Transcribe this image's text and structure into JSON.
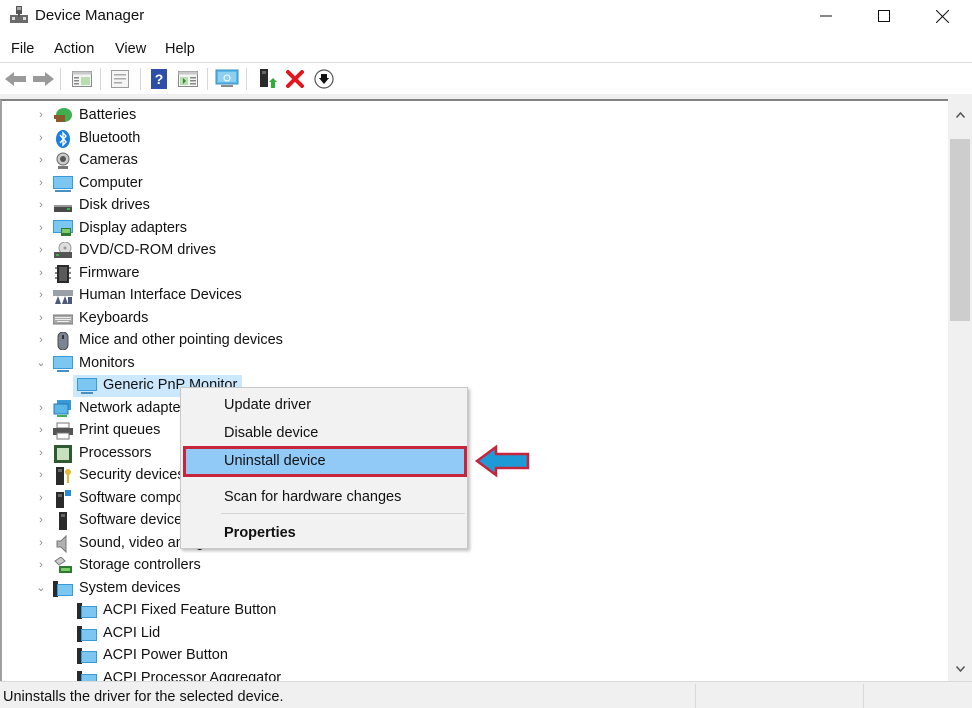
{
  "window": {
    "title": "Device Manager",
    "icon": "device-manager-icon",
    "controls": {
      "minimize": "minimize-icon",
      "maximize": "maximize-icon",
      "close": "close-icon"
    }
  },
  "menubar": {
    "items": [
      "File",
      "Action",
      "View",
      "Help"
    ]
  },
  "toolbar": {
    "buttons": [
      {
        "name": "back",
        "icon": "back-arrow-icon"
      },
      {
        "name": "forward",
        "icon": "forward-arrow-icon"
      },
      {
        "name": "show-hide-console-tree",
        "icon": "console-tree-icon"
      },
      {
        "name": "properties",
        "icon": "properties-icon"
      },
      {
        "name": "help",
        "icon": "help-icon"
      },
      {
        "name": "show-action-pane",
        "icon": "action-pane-icon"
      },
      {
        "name": "scan-hardware",
        "icon": "monitor-scan-icon"
      },
      {
        "name": "update-driver",
        "icon": "update-driver-icon"
      },
      {
        "name": "uninstall-device",
        "icon": "red-x-icon"
      },
      {
        "name": "disable-device",
        "icon": "down-arrow-circle-icon"
      }
    ]
  },
  "tree": {
    "nodes": [
      {
        "label": "Batteries",
        "icon": "battery-icon",
        "expanded": false,
        "level": 0
      },
      {
        "label": "Bluetooth",
        "icon": "bluetooth-icon",
        "expanded": false,
        "level": 0
      },
      {
        "label": "Cameras",
        "icon": "camera-icon",
        "expanded": false,
        "level": 0
      },
      {
        "label": "Computer",
        "icon": "computer-icon",
        "expanded": false,
        "level": 0
      },
      {
        "label": "Disk drives",
        "icon": "disk-drive-icon",
        "expanded": false,
        "level": 0
      },
      {
        "label": "Display adapters",
        "icon": "display-adapter-icon",
        "expanded": false,
        "level": 0
      },
      {
        "label": "DVD/CD-ROM drives",
        "icon": "dvd-drive-icon",
        "expanded": false,
        "level": 0
      },
      {
        "label": "Firmware",
        "icon": "firmware-icon",
        "expanded": false,
        "level": 0
      },
      {
        "label": "Human Interface Devices",
        "icon": "hid-icon",
        "expanded": false,
        "level": 0
      },
      {
        "label": "Keyboards",
        "icon": "keyboard-icon",
        "expanded": false,
        "level": 0
      },
      {
        "label": "Mice and other pointing devices",
        "icon": "mouse-icon",
        "expanded": false,
        "level": 0
      },
      {
        "label": "Monitors",
        "icon": "monitor-icon",
        "expanded": true,
        "level": 0
      },
      {
        "label": "Generic PnP Monitor",
        "icon": "monitor-icon",
        "level": 1,
        "selected": true
      },
      {
        "label": "Network adapters",
        "icon": "network-adapter-icon",
        "expanded": false,
        "level": 0
      },
      {
        "label": "Print queues",
        "icon": "printer-icon",
        "expanded": false,
        "level": 0
      },
      {
        "label": "Processors",
        "icon": "processor-icon",
        "expanded": false,
        "level": 0
      },
      {
        "label": "Security devices",
        "icon": "security-device-icon",
        "expanded": false,
        "level": 0
      },
      {
        "label": "Software components",
        "icon": "software-component-icon",
        "expanded": false,
        "level": 0
      },
      {
        "label": "Software devices",
        "icon": "software-device-icon",
        "expanded": false,
        "level": 0
      },
      {
        "label": "Sound, video and game controllers",
        "icon": "speaker-icon",
        "expanded": false,
        "level": 0
      },
      {
        "label": "Storage controllers",
        "icon": "storage-controller-icon",
        "expanded": false,
        "level": 0
      },
      {
        "label": "System devices",
        "icon": "system-device-icon",
        "expanded": true,
        "level": 0
      },
      {
        "label": "ACPI Fixed Feature Button",
        "icon": "system-device-icon",
        "level": 1
      },
      {
        "label": "ACPI Lid",
        "icon": "system-device-icon",
        "level": 1
      },
      {
        "label": "ACPI Power Button",
        "icon": "system-device-icon",
        "level": 1
      },
      {
        "label": "ACPI Processor Aggregator",
        "icon": "system-device-icon",
        "level": 1
      }
    ]
  },
  "context_menu": {
    "items": [
      {
        "label": "Update driver"
      },
      {
        "label": "Disable device"
      },
      {
        "label": "Uninstall device",
        "highlighted": true
      },
      {
        "label": "Scan for hardware changes"
      },
      {
        "label": "Properties",
        "bold": true
      }
    ]
  },
  "annotation": {
    "arrow_icon": "left-pointing-arrow-icon",
    "arrow_fill": "#1e9bd7",
    "arrow_stroke": "#c8243a"
  },
  "statusbar": {
    "text": "Uninstalls the driver for the selected device."
  },
  "colors": {
    "selection": "#cce8ff",
    "menu_highlight": "#91c9f7",
    "highlight_border": "#c8243a"
  }
}
